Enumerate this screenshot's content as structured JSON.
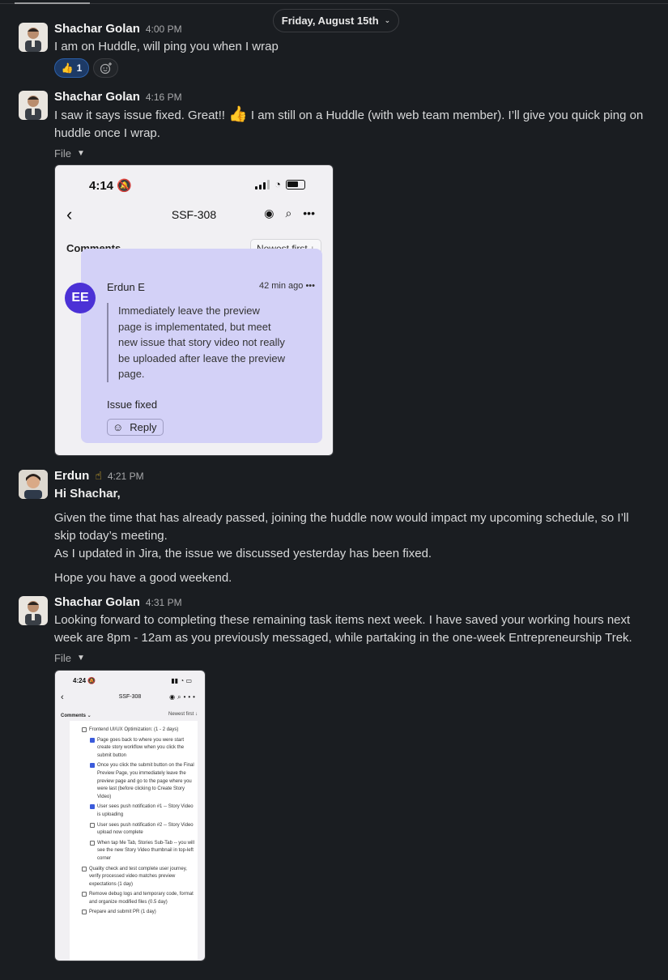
{
  "date_divider": {
    "label": "Friday, August 15th"
  },
  "messages": [
    {
      "author": "Shachar Golan",
      "time": "4:00 PM",
      "text": "I am on Huddle, will ping you when I wrap",
      "reactions": {
        "thumbs_up_count": "1"
      }
    },
    {
      "author": "Shachar Golan",
      "time": "4:16 PM",
      "text_before_emoji": "I saw it says issue fixed. Great!! ",
      "text_after_emoji": " I am still on a Huddle (with web team member). I’ll give you quick ping on huddle once I wrap.",
      "file_label": "File"
    },
    {
      "author": "Erdun",
      "author_emoji": "☝",
      "time": "4:21 PM",
      "greeting": "Hi Shachar,",
      "para1": "Given the time that has already passed, joining the huddle now would impact my upcoming schedule, so I’ll skip today’s meeting.",
      "para2": "As I updated in Jira, the issue we discussed yesterday has been fixed.",
      "para3": "Hope you have a good weekend."
    },
    {
      "author": "Shachar Golan",
      "time": "4:31 PM",
      "text": "Looking forward to completing these remaining task items next week. I have saved your working hours next week are 8pm - 12am as you previously messaged, while partaking in the one-week Entrepreneurship Trek.",
      "file_label": "File"
    }
  ],
  "attachment1": {
    "status_time": "4:14",
    "title": "SSF-308",
    "comments_label": "Comments",
    "sort_label": "Newest first",
    "avatar_initials": "EE",
    "comment_author": "Erdun E",
    "comment_age": "42 min ago",
    "quote": "Immediately leave the preview page is implementated, but meet new issue that story video not really be uploaded after leave the preview page.",
    "reply_text": "Issue fixed",
    "reply_button": "Reply"
  },
  "attachment2": {
    "status_time": "4:24",
    "title": "SSF-308",
    "comments_label": "Comments",
    "sort_label": "Newest first",
    "tasks": [
      {
        "text": "Frontend UI/UX Optimization: (1 - 2 days)",
        "checked": false,
        "sub": false
      },
      {
        "text": "Page goes back to where you were start create story workflow when you click the submit button",
        "checked": true,
        "sub": true
      },
      {
        "text": "Once you click the submit button on the Final Preview Page, you immediately leave the preview page and go to the page where you were last (before clicking to Create Story Video)",
        "checked": true,
        "sub": true
      },
      {
        "text": "User sees push notification #1 -- Story Video is uploading",
        "checked": true,
        "sub": true
      },
      {
        "text": "User sees push notification #2 -- Story Video upload now complete",
        "checked": false,
        "sub": true
      },
      {
        "text": "When tap Me Tab, Stories Sub-Tab -- you will see the new Story Video thumbnail in top-left corner",
        "checked": false,
        "sub": true
      },
      {
        "text": "Quality check and test complete user journey, verify processed video matches preview expectations (1 day)",
        "checked": false,
        "sub": false
      },
      {
        "text": "Remove debug logs and temporary code, format and organize modified files (0.5 day)",
        "checked": false,
        "sub": false
      },
      {
        "text": "Prepare and submit PR (1 day)",
        "checked": false,
        "sub": false
      }
    ]
  }
}
